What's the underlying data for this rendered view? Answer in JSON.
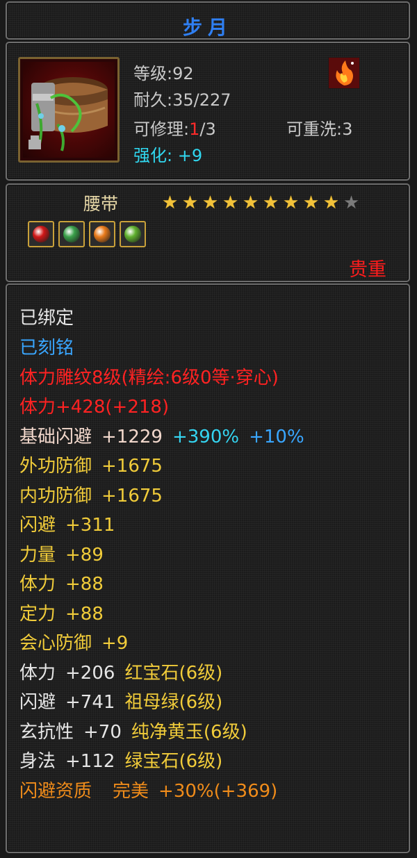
{
  "item": {
    "name": "步月",
    "level_label": "等级:92",
    "durability_label": "耐久:35/227",
    "repair_prefix": "可修理:",
    "repair_used": "1",
    "repair_total": "/3",
    "reroll_label": "可重洗:3",
    "enhance_label": "强化: +9",
    "type": "腰带",
    "stars_filled": 9,
    "stars_total": 10,
    "quality": "贵重",
    "gem_colors": [
      "#d01818",
      "#3aa04a",
      "#e87a1a",
      "#5fb02e"
    ]
  },
  "attributes": {
    "bound": "已绑定",
    "engraved": "已刻铭",
    "carving": "体力雕纹8级(精绘:6级0等·穿心)",
    "stamina_total": "体力+428(+218)",
    "base_dodge_label": "基础闪避",
    "base_dodge_value": "+1229",
    "base_dodge_bonus1": "+390%",
    "base_dodge_bonus2": "+10%",
    "outer_def_label": "外功防御",
    "outer_def_value": "+1675",
    "inner_def_label": "内功防御",
    "inner_def_value": "+1675",
    "dodge_label": "闪避",
    "dodge_value": "+311",
    "strength_label": "力量",
    "strength_value": "+89",
    "stamina_label": "体力",
    "stamina_value": "+88",
    "focus_label": "定力",
    "focus_value": "+88",
    "crit_def_label": "会心防御",
    "crit_def_value": "+9",
    "gem1_stat": "体力",
    "gem1_value": "+206",
    "gem1_name": "红宝石(6级)",
    "gem2_stat": "闪避",
    "gem2_value": "+741",
    "gem2_name": "祖母绿(6级)",
    "gem3_stat": "玄抗性",
    "gem3_value": "+70",
    "gem3_name": "纯净黄玉(6级)",
    "gem4_stat": "身法",
    "gem4_value": "+112",
    "gem4_name": "绿宝石(6级)",
    "aptitude_label": "闪避资质",
    "aptitude_grade": "完美",
    "aptitude_value": "+30%(+369)"
  }
}
